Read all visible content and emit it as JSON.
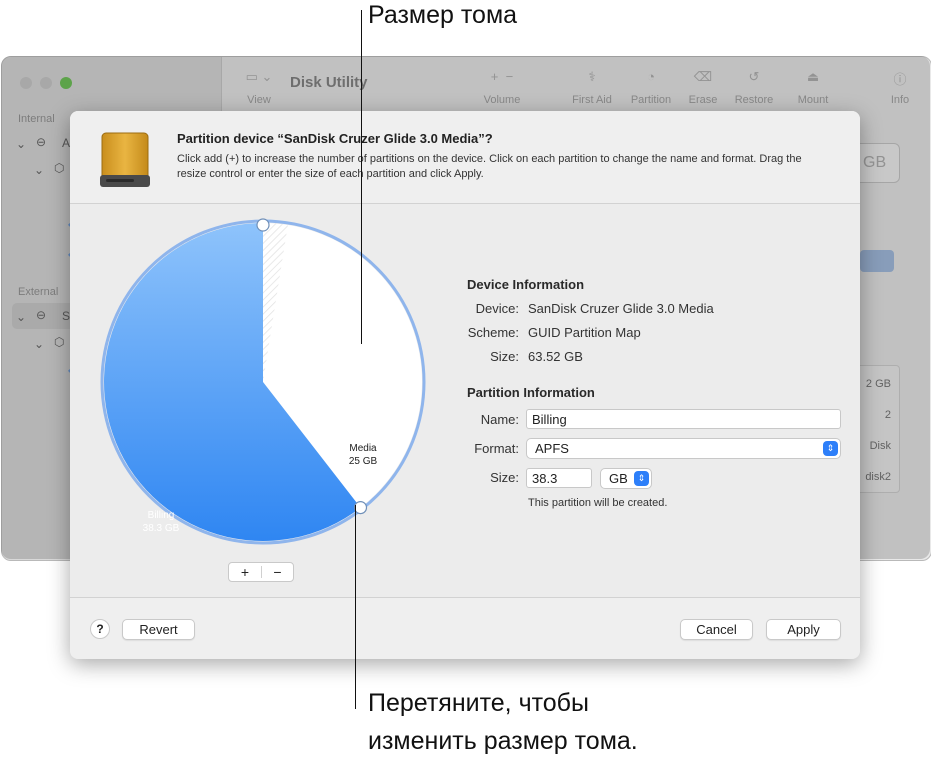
{
  "callouts": {
    "top": "Размер тома",
    "bottom_line1": "Перетяните, чтобы",
    "bottom_line2": "изменить размер тома."
  },
  "background_window": {
    "title": "Disk Utility",
    "toolbar": {
      "view": "View",
      "volume": "Volume",
      "first_aid": "First Aid",
      "partition": "Partition",
      "erase": "Erase",
      "restore": "Restore",
      "mount": "Mount",
      "info": "Info"
    },
    "sidebar": {
      "internal_header": "Internal",
      "external_header": "External",
      "internal_item": "A",
      "external_item": "Sa"
    },
    "right_fragments": {
      "size_box": "GB",
      "row1": "2 GB",
      "row2": "2",
      "row3": "Disk",
      "row4": "disk2"
    }
  },
  "sheet": {
    "title": "Partition device “SanDisk Cruzer Glide 3.0 Media”?",
    "description": "Click add (+) to increase the number of partitions on the device. Click on each partition to change the name and format. Drag the resize control or enter the size of each partition and click Apply.",
    "pie": {
      "billing": {
        "name": "Billing",
        "size": "38.3 GB",
        "value_gb": 38.3,
        "color": "#3d8ff0"
      },
      "media": {
        "name": "Media",
        "size": "25 GB",
        "value_gb": 25,
        "color": "#ffffff"
      }
    },
    "add_symbol": "+",
    "remove_symbol": "−",
    "device_info": {
      "header": "Device Information",
      "device_label": "Device:",
      "device_value": "SanDisk Cruzer Glide 3.0 Media",
      "scheme_label": "Scheme:",
      "scheme_value": "GUID Partition Map",
      "size_label": "Size:",
      "size_value": "63.52 GB"
    },
    "partition_info": {
      "header": "Partition Information",
      "name_label": "Name:",
      "name_value": "Billing",
      "format_label": "Format:",
      "format_value": "APFS",
      "size_label": "Size:",
      "size_value": "38.3",
      "unit_value": "GB",
      "note": "This partition will be created."
    },
    "buttons": {
      "help": "?",
      "revert": "Revert",
      "cancel": "Cancel",
      "apply": "Apply"
    }
  },
  "colors": {
    "accent": "#2d7ff9",
    "billing_blue": "#3d8ff0",
    "ring_blue": "#8fb5ec"
  }
}
